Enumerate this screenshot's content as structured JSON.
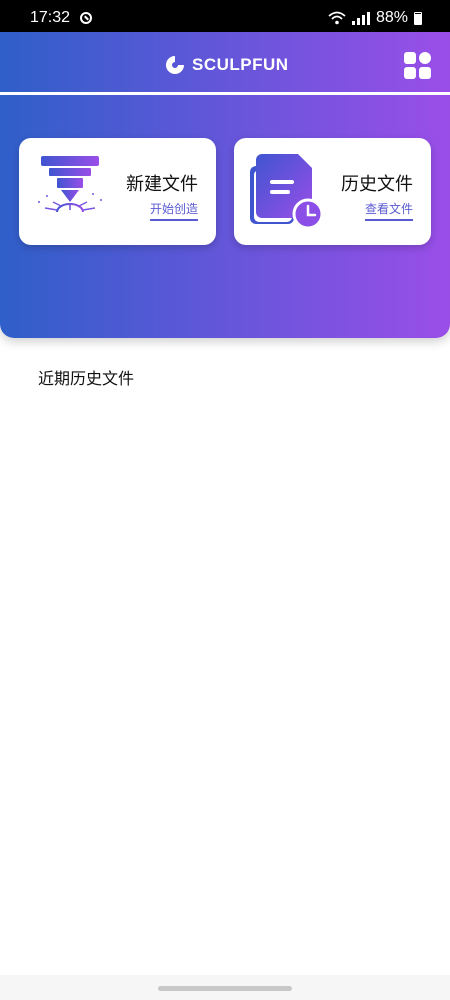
{
  "status_bar": {
    "time": "17:32",
    "battery": "88%"
  },
  "header": {
    "brand": "SCULPFUN",
    "grid_icon": "grid-apps-icon"
  },
  "cards": {
    "new_file": {
      "title": "新建文件",
      "link": "开始创造",
      "icon": "laser-engraver-icon"
    },
    "history": {
      "title": "历史文件",
      "link": "查看文件",
      "icon": "history-document-icon"
    }
  },
  "recent": {
    "title": "近期历史文件"
  },
  "colors": {
    "gradient_start": "#2f5fc9",
    "gradient_end": "#9a4ee8",
    "accent": "#5a5bd0"
  }
}
